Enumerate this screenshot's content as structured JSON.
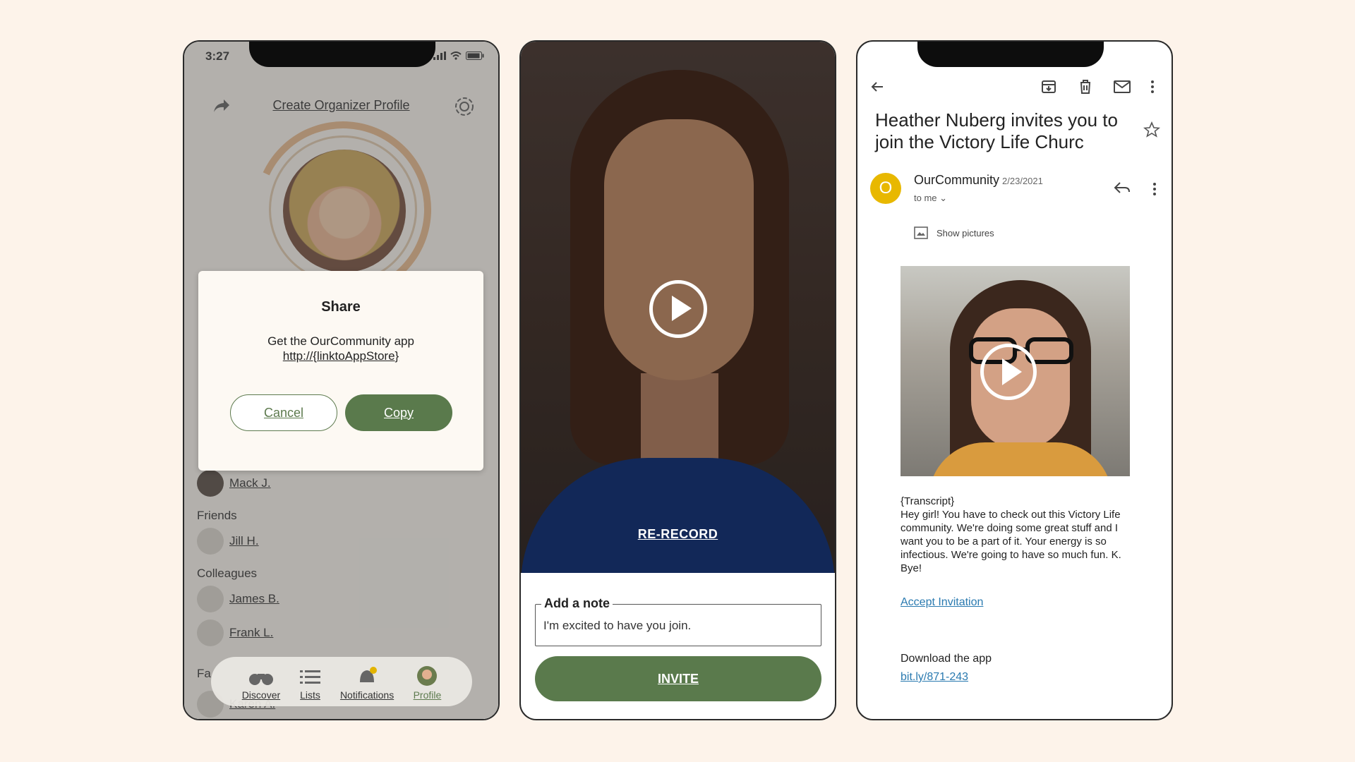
{
  "phone1": {
    "status_time": "3:27",
    "header_title": "Create Organizer Profile",
    "contacts": {
      "mack": "Mack J.",
      "friends_label": "Friends",
      "jill": "Jill H.",
      "colleagues_label": "Colleagues",
      "james": "James B.",
      "frank": "Frank L.",
      "fa_label": "Fa",
      "karen": "Karen A."
    },
    "tabs": {
      "discover": "Discover",
      "lists": "Lists",
      "notifications": "Notifications",
      "profile": "Profile"
    },
    "dialog": {
      "title": "Share",
      "text": "Get the OurCommunity app",
      "link": "http://{linktoAppStore}",
      "cancel": "Cancel",
      "copy": "Copy"
    },
    "accent_color": "#5a7a4c"
  },
  "phone2": {
    "rerecord": "RE-RECORD",
    "note_label": "Add a note",
    "note_value": "I'm excited to have you join.",
    "invite": "INVITE"
  },
  "phone3": {
    "subject": "Heather Nuberg invites you to join the Victory Life Churc",
    "sender_initial": "O",
    "sender_name": "OurCommunity",
    "sender_date": "2/23/2021",
    "to_me": "to me",
    "show_pictures": "Show pictures",
    "transcript_tag": "{Transcript}",
    "body": "Hey girl! You have to check out this Victory Life community. We're doing some great stuff and I want you to be a part of it. Your energy is so infectious. We're going to have so much fun. K. Bye!",
    "accept": "Accept Invitation",
    "download_label": "Download the app",
    "download_link": "bit.ly/871-243",
    "link_color": "#2a7ab0"
  }
}
